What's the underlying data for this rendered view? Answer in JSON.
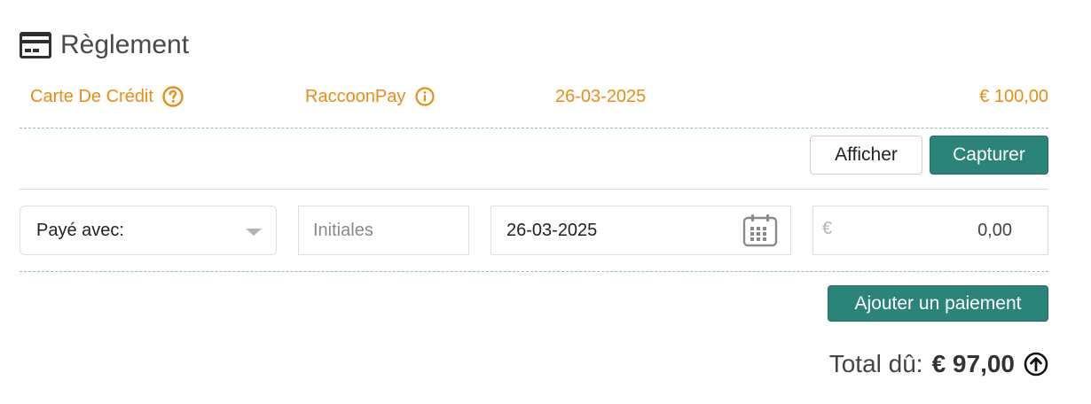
{
  "section": {
    "title": "Règlement",
    "icon": "credit-card-icon"
  },
  "payment": {
    "method": "Carte De Crédit",
    "method_icon": "question-circle-icon",
    "provider": "RaccoonPay",
    "provider_icon": "info-circle-icon",
    "date": "26-03-2025",
    "amount": "€ 100,00",
    "accent_color": "#ec8c12"
  },
  "actions": {
    "show_label": "Afficher",
    "capture_label": "Capturer"
  },
  "form": {
    "paid_with_label": "Payé avec:",
    "initials_placeholder": "Initiales",
    "date_value": "26-03-2025",
    "currency_symbol": "€",
    "amount_value": "0,00",
    "add_payment_label": "Ajouter un paiement"
  },
  "summary": {
    "total_label": "Total dû:",
    "total_amount": "€ 97,00",
    "toggle_icon": "arrow-up-circle-icon"
  },
  "colors": {
    "teal": "#2b8379",
    "orange": "#ec8c12"
  }
}
